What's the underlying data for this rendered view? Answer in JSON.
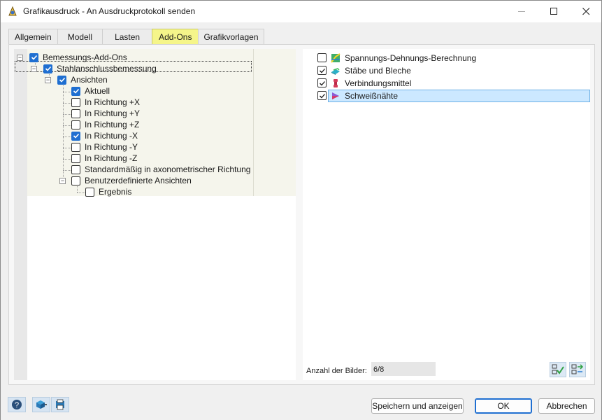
{
  "window": {
    "title": "Grafikausdruck - An Ausdruckprotokoll senden"
  },
  "tabs": [
    {
      "label": "Allgemein",
      "active": false
    },
    {
      "label": "Modell",
      "active": false
    },
    {
      "label": "Lasten",
      "active": false
    },
    {
      "label": "Add-Ons",
      "active": true
    },
    {
      "label": "Grafikvorlagen",
      "active": false
    }
  ],
  "tree": {
    "items": [
      {
        "label": "Bemessungs-Add-Ons",
        "checked": true,
        "expander": "−"
      },
      {
        "label": "Stahlanschlussbemessung",
        "checked": true,
        "expander": "−"
      },
      {
        "label": "Ansichten",
        "checked": true,
        "expander": "−"
      },
      {
        "label": "Aktuell",
        "checked": true
      },
      {
        "label": "In Richtung +X",
        "checked": false
      },
      {
        "label": "In Richtung +Y",
        "checked": false
      },
      {
        "label": "In Richtung +Z",
        "checked": false
      },
      {
        "label": "In Richtung -X",
        "checked": true
      },
      {
        "label": "In Richtung -Y",
        "checked": false
      },
      {
        "label": "In Richtung -Z",
        "checked": false
      },
      {
        "label": "Standardmäßig in axonometrischer Richtung",
        "checked": false
      },
      {
        "label": "Benutzerdefinierte Ansichten",
        "checked": false,
        "expander": "−"
      },
      {
        "label": "Ergebnis",
        "checked": false
      }
    ]
  },
  "results_list": {
    "items": [
      {
        "label": "Spannungs-Dehnungs-Berechnung",
        "checked": false,
        "icon": "stress-strain-icon"
      },
      {
        "label": "Stäbe und Bleche",
        "checked": true,
        "icon": "members-plates-icon"
      },
      {
        "label": "Verbindungsmittel",
        "checked": true,
        "icon": "bolts-icon"
      },
      {
        "label": "Schweißnähte",
        "checked": true,
        "icon": "welds-icon",
        "selected": true
      }
    ],
    "count_label": "Anzahl der Bilder:",
    "count_value": "6/8"
  },
  "buttons": {
    "save_show": "Speichern und anzeigen",
    "ok": "OK",
    "cancel": "Abbrechen"
  },
  "colors": {
    "active_tab": "#f5f58a",
    "checkbox_blue": "#1f6fd1",
    "selection": "#cce8ff"
  }
}
